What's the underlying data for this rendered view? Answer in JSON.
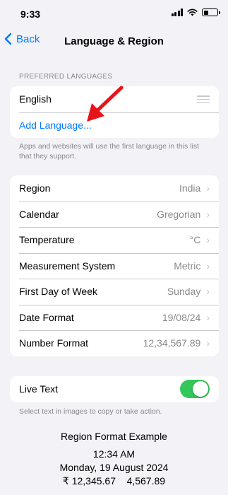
{
  "status": {
    "time": "9:33"
  },
  "nav": {
    "back_label": "Back",
    "title": "Language & Region"
  },
  "preferred": {
    "header": "PREFERRED LANGUAGES",
    "language": "English",
    "add_label": "Add Language...",
    "note": "Apps and websites will use the first language in this list that they support."
  },
  "settings": [
    {
      "label": "Region",
      "value": "India"
    },
    {
      "label": "Calendar",
      "value": "Gregorian"
    },
    {
      "label": "Temperature",
      "value": "°C"
    },
    {
      "label": "Measurement System",
      "value": "Metric"
    },
    {
      "label": "First Day of Week",
      "value": "Sunday"
    },
    {
      "label": "Date Format",
      "value": "19/08/24"
    },
    {
      "label": "Number Format",
      "value": "12,34,567.89"
    }
  ],
  "live_text": {
    "label": "Live Text",
    "enabled": true,
    "note": "Select text in images to copy or take action."
  },
  "example": {
    "title": "Region Format Example",
    "time": "12:34 AM",
    "date": "Monday, 19 August 2024",
    "numbers": "₹ 12,345.67    4,567.89"
  },
  "colors": {
    "accent": "#007aff",
    "toggle_on": "#34c759",
    "annotation_arrow": "#e8141b"
  }
}
